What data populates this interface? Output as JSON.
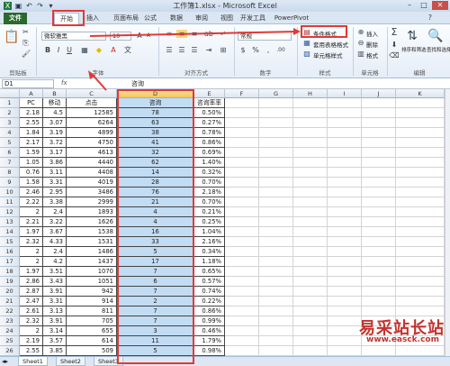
{
  "window": {
    "title": "工作簿1.xlsx - Microsoft Excel"
  },
  "tabs": [
    "文件",
    "开始",
    "插入",
    "页面布局",
    "公式",
    "数据",
    "审阅",
    "视图",
    "开发工具",
    "PowerPivot"
  ],
  "ribbon": {
    "font_name": "微软雅黑",
    "font_size": "10",
    "number_format": "常规",
    "conditional_format": "条件格式",
    "table_format": "套用表格格式",
    "cell_styles": "单元格样式",
    "insert": "插入",
    "delete": "删除",
    "format": "格式",
    "sort_filter": "排序和筛选",
    "find_select": "查找和选择",
    "groups": {
      "clipboard": "剪贴板",
      "font": "字体",
      "alignment": "对齐方式",
      "number": "数字",
      "styles": "样式",
      "cells": "单元格",
      "editing": "编辑"
    },
    "bold": "B",
    "italic": "I",
    "underline": "U",
    "sum": "Σ",
    "percent": "%"
  },
  "formula_bar": {
    "name_box": "D1",
    "fx": "fx",
    "content": "咨询"
  },
  "columns": [
    "A",
    "B",
    "C",
    "D",
    "E",
    "F",
    "G",
    "H",
    "I",
    "J",
    "K"
  ],
  "headers": [
    "PC",
    "移动",
    "点击",
    "咨询",
    "咨询率率"
  ],
  "rows": [
    [
      "2.18",
      "4.5",
      "12585",
      "78",
      "0.50%"
    ],
    [
      "2.55",
      "3.07",
      "6264",
      "63",
      "0.27%"
    ],
    [
      "1.84",
      "3.19",
      "4899",
      "38",
      "0.78%"
    ],
    [
      "2.17",
      "3.72",
      "4750",
      "41",
      "0.86%"
    ],
    [
      "1.59",
      "3.17",
      "4613",
      "32",
      "0.69%"
    ],
    [
      "1.05",
      "3.86",
      "4440",
      "62",
      "1.40%"
    ],
    [
      "0.76",
      "3.11",
      "4408",
      "14",
      "0.32%"
    ],
    [
      "1.58",
      "3.31",
      "4019",
      "28",
      "0.70%"
    ],
    [
      "2.46",
      "2.95",
      "3486",
      "76",
      "2.18%"
    ],
    [
      "2.22",
      "3.38",
      "2999",
      "21",
      "0.70%"
    ],
    [
      "2",
      "2.4",
      "1893",
      "4",
      "0.21%"
    ],
    [
      "2.21",
      "3.22",
      "1626",
      "4",
      "0.25%"
    ],
    [
      "1.97",
      "3.67",
      "1538",
      "16",
      "1.04%"
    ],
    [
      "2.32",
      "4.33",
      "1531",
      "33",
      "2.16%"
    ],
    [
      "2",
      "2.4",
      "1486",
      "5",
      "0.34%"
    ],
    [
      "2",
      "4.2",
      "1437",
      "17",
      "1.18%"
    ],
    [
      "1.97",
      "3.51",
      "1070",
      "7",
      "0.65%"
    ],
    [
      "2.86",
      "3.43",
      "1051",
      "6",
      "0.57%"
    ],
    [
      "2.87",
      "3.91",
      "942",
      "7",
      "0.74%"
    ],
    [
      "2.47",
      "3.31",
      "914",
      "2",
      "0.22%"
    ],
    [
      "2.61",
      "3.13",
      "811",
      "7",
      "0.86%"
    ],
    [
      "2.32",
      "3.91",
      "705",
      "7",
      "0.99%"
    ],
    [
      "2",
      "3.14",
      "655",
      "3",
      "0.46%"
    ],
    [
      "2.19",
      "3.57",
      "614",
      "11",
      "1.79%"
    ],
    [
      "2.55",
      "3.85",
      "509",
      "5",
      "0.98%"
    ]
  ],
  "row_numbers": [
    "1",
    "2",
    "3",
    "4",
    "5",
    "6",
    "7",
    "8",
    "9",
    "10",
    "11",
    "12",
    "13",
    "14",
    "15",
    "16",
    "17",
    "18",
    "19",
    "20",
    "21",
    "22",
    "23",
    "24",
    "25",
    "26"
  ],
  "sheets": [
    "Sheet1",
    "Sheet2",
    "Sheet3"
  ],
  "watermark": {
    "title": "易采站长站",
    "url": "www.easck.com"
  },
  "colors": {
    "accent_red": "#e03a36",
    "file_tab": "#2a6a2f",
    "selection": "#c2dcf4"
  }
}
